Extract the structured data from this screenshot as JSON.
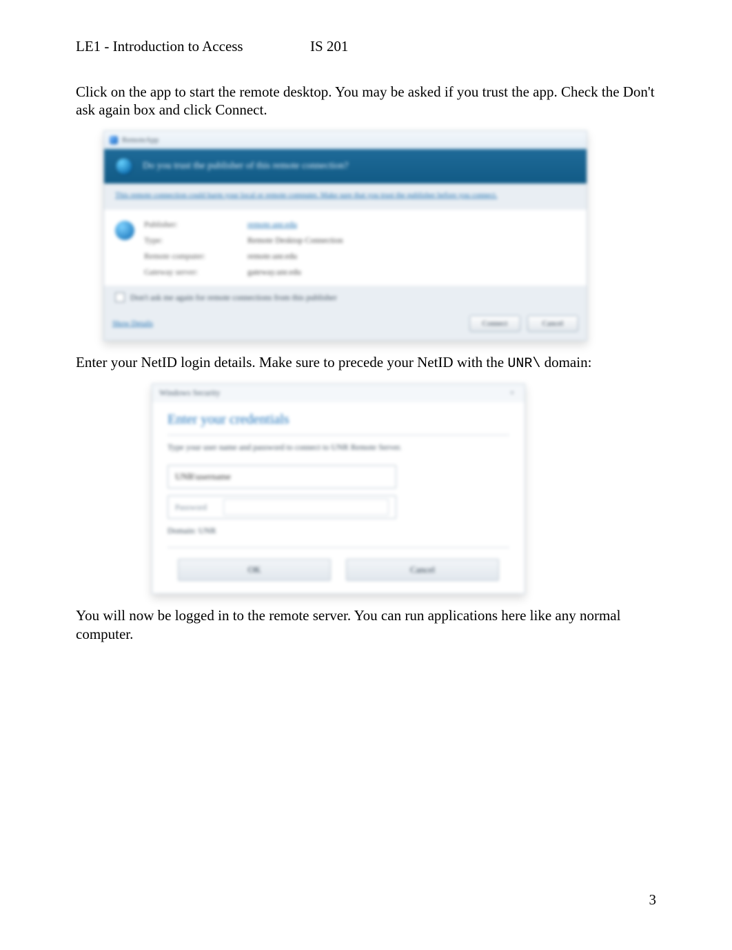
{
  "header": {
    "left": "LE1 - Introduction to Access",
    "right": "IS 201"
  },
  "paragraphs": {
    "p1": "Click on the app to start the remote desktop. You may be asked if you trust the app. Check the Don't ask again box and click Connect.",
    "p2a": "Enter your NetID login details. Make sure to precede your NetID with the ",
    "p2b_mono": "UNR\\",
    "p2c": " domain:",
    "p3": "You will now be logged in to the remote server. You can run applications here like any normal computer."
  },
  "dialog1": {
    "title": "RemoteApp",
    "banner": "Do you trust the publisher of this remote connection?",
    "subtext": "This remote connection could harm your local or remote computer. Make sure that you trust the publisher before you connect.",
    "rows": {
      "k0": "Publisher:",
      "v0": "remote.unr.edu",
      "k1": "Type:",
      "v1": "Remote Desktop Connection",
      "k2": "Remote computer:",
      "v2": "remote.unr.edu",
      "k3": "Gateway server:",
      "v3": "gateway.unr.edu"
    },
    "checkbox": "Don't ask me again for remote connections from this publisher",
    "details": "Show Details",
    "connect": "Connect",
    "cancel": "Cancel"
  },
  "dialog2": {
    "title": "Windows Security",
    "close": "×",
    "heading": "Enter your credentials",
    "subtext": "Type your user name and password to connect to UNR Remote Server.",
    "username": "UNR\\username",
    "pw_label": "Password",
    "domain": "Domain: UNR",
    "ok": "OK",
    "cancel": "Cancel"
  },
  "page_number": "3"
}
